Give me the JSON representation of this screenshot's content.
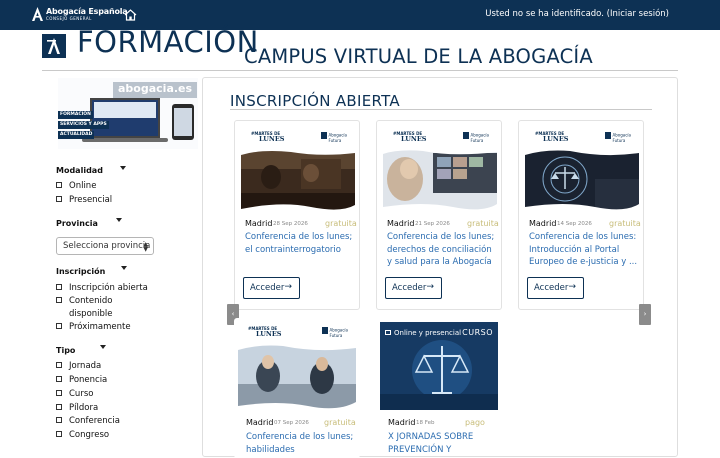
{
  "topbar": {
    "brand_name": "Abogacía Española",
    "brand_sub": "CONSEJO GENERAL",
    "login_text": "Usted no se ha identificado. (Iniciar sesión)"
  },
  "header": {
    "formacion": "FORMACIÓN",
    "campus_title": "CAMPUS VIRTUAL DE LA ABOGACÍA"
  },
  "banner": {
    "site": "abogacia.es",
    "tags": [
      "FORMACIÓN",
      "SERVICIOS Y APPS",
      "ACTUALIDAD"
    ]
  },
  "filters": {
    "modalidad": {
      "title": "Modalidad",
      "options": [
        "Online",
        "Presencial"
      ]
    },
    "provincia": {
      "title": "Provincia",
      "select_value": "Selecciona provincia"
    },
    "inscripcion": {
      "title": "Inscripción",
      "options": [
        "Inscripción abierta",
        "Contenido disponible",
        "Próximamente"
      ]
    },
    "tipo": {
      "title": "Tipo",
      "options": [
        "Jornada",
        "Ponencia",
        "Curso",
        "Píldora",
        "Conferencia",
        "Congreso"
      ]
    }
  },
  "main": {
    "section_title": "INSCRIPCIÓN ABIERTA",
    "prev_icon": "chevron-left-icon",
    "next_icon": "chevron-right-icon",
    "lunes_top": "#MARTES DE",
    "lunes_bottom": "LUNES",
    "af_line1": "Abogacía",
    "af_line2": "Futura",
    "cards": [
      {
        "city": "Madrid",
        "date": "28 Sep 2026",
        "price": "gratuita",
        "title": "Conferencia de los lunes; el contrainterrogatorio",
        "button": "Acceder",
        "arrow": "→"
      },
      {
        "city": "Madrid",
        "date": "21 Sep 2026",
        "price": "gratuita",
        "title": "Conferencia de los lunes; derechos de conciliación y salud para la Abogacía",
        "button": "Acceder",
        "arrow": "→"
      },
      {
        "city": "Madrid",
        "date": "14 Sep 2026",
        "price": "gratuita",
        "title": "Conferencia de los lunes: Introducción al Portal Europeo de e-justicia y ...",
        "button": "Acceder",
        "arrow": "→"
      },
      {
        "city": "Madrid",
        "date": "07 Sep 2026",
        "price": "gratuita",
        "title": "Conferencia de los lunes; habilidades",
        "button": "",
        "arrow": ""
      },
      {
        "city": "Madrid",
        "date": "18 Feb",
        "price": "pago",
        "title": "X JORNADAS SOBRE PREVENCIÓN Y",
        "button": "",
        "arrow": "",
        "badge": "Online y presencial",
        "tag": "CURSO"
      }
    ]
  },
  "colors": {
    "navy": "#0d3154",
    "link": "#2b6cb0",
    "price": "#c8bd7a"
  }
}
